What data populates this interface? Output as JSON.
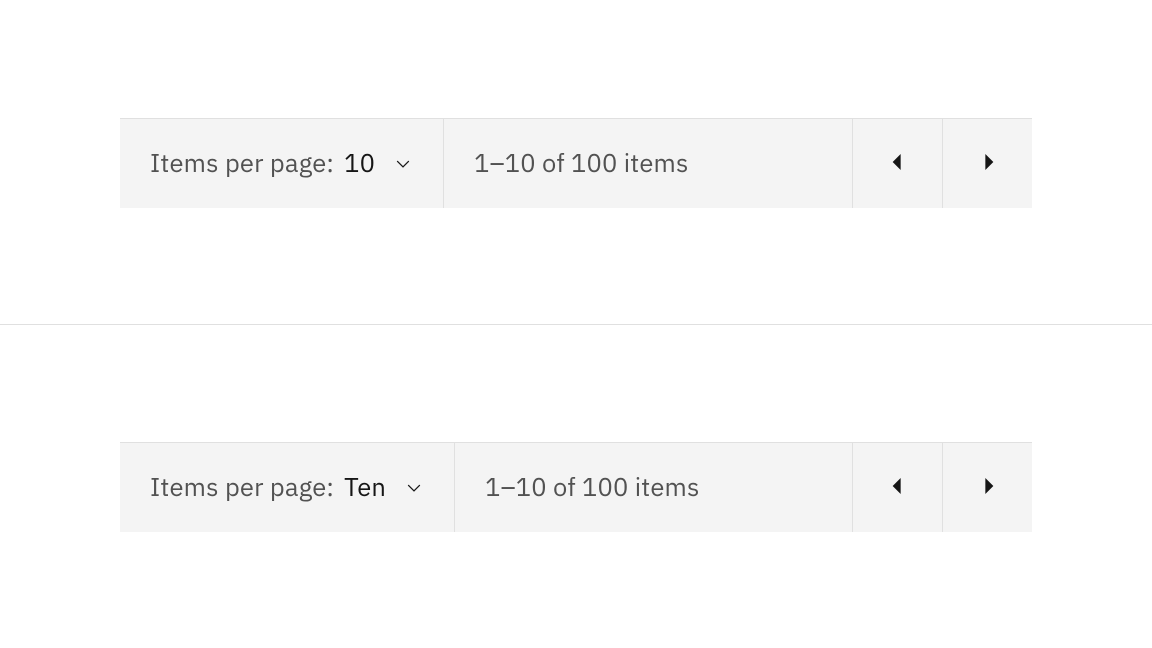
{
  "pagination1": {
    "items_per_page_label": "Items per page:",
    "page_size_value": "10",
    "range_text": "1–10 of 100 items"
  },
  "pagination2": {
    "items_per_page_label": "Items per page:",
    "page_size_value": "Ten",
    "range_text": "1–10 of 100 items"
  }
}
